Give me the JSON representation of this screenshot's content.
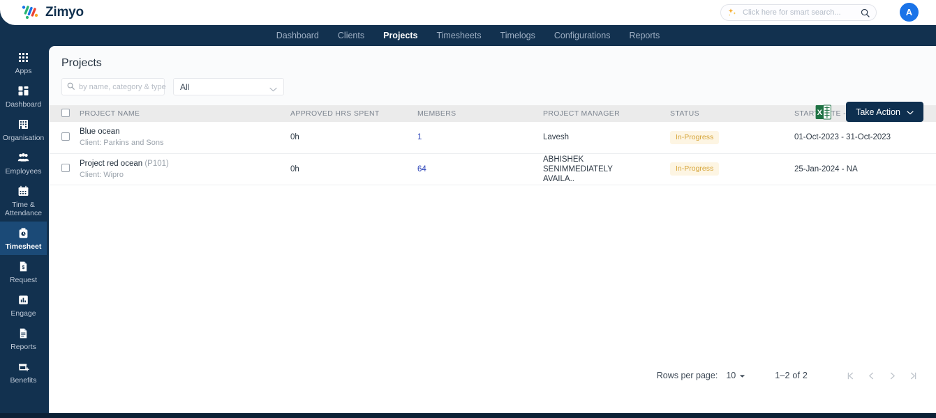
{
  "brand": {
    "name": "Zimyo",
    "logo_icon": "zimyo-logo-icon"
  },
  "topbar": {
    "search": {
      "placeholder": "Click here for smart search...",
      "value": "",
      "sparkle_icon": "sparkle-icon",
      "magnifier_icon": "search-icon"
    },
    "avatar_initial": "A",
    "avatar_color": "#1a73e8"
  },
  "nav": {
    "items": [
      {
        "label": "Dashboard",
        "active": false
      },
      {
        "label": "Clients",
        "active": false
      },
      {
        "label": "Projects",
        "active": true
      },
      {
        "label": "Timesheets",
        "active": false
      },
      {
        "label": "Timelogs",
        "active": false
      },
      {
        "label": "Configurations",
        "active": false
      },
      {
        "label": "Reports",
        "active": false
      }
    ]
  },
  "sidebar": {
    "items": [
      {
        "label": "Apps",
        "icon": "apps-grid-icon",
        "active": false
      },
      {
        "label": "Dashboard",
        "icon": "dashboard-squares-icon",
        "active": false
      },
      {
        "label": "Organisation",
        "icon": "building-icon",
        "active": false
      },
      {
        "label": "Employees",
        "icon": "people-icon",
        "active": false
      },
      {
        "label": "Time & Attendance",
        "icon": "calendar-icon",
        "active": false
      },
      {
        "label": "Timesheet",
        "icon": "timesheet-clock-icon",
        "active": true
      },
      {
        "label": "Request",
        "icon": "request-document-icon",
        "active": false
      },
      {
        "label": "Engage",
        "icon": "engage-chart-icon",
        "active": false
      },
      {
        "label": "Reports",
        "icon": "reports-document-icon",
        "active": false
      },
      {
        "label": "Benefits",
        "icon": "benefits-cart-icon",
        "active": false
      }
    ]
  },
  "page": {
    "title": "Projects",
    "search": {
      "placeholder": "by name, category & type",
      "value": ""
    },
    "filter_select": {
      "value": "All"
    },
    "export_icon": "excel-export-icon",
    "take_action_label": "Take Action"
  },
  "table": {
    "columns": [
      "PROJECT NAME",
      "APPROVED HRS SPENT",
      "MEMBERS",
      "PROJECT MANAGER",
      "STATUS",
      "START DATE - END DATE"
    ],
    "rows": [
      {
        "name": "Blue ocean",
        "code": "",
        "client": "Client: Parkins and Sons",
        "approved_hrs": "0h",
        "members": "1",
        "project_manager": "Lavesh",
        "status": "In-Progress",
        "dates": "01-Oct-2023 - 31-Oct-2023"
      },
      {
        "name": "Project red ocean",
        "code": "(P101)",
        "client": "Client: Wipro",
        "approved_hrs": "0h",
        "members": "64",
        "project_manager": "ABHISHEK SENIMMEDIATELY AVAILA..",
        "status": "In-Progress",
        "dates": "25-Jan-2024 - NA"
      }
    ]
  },
  "pagination": {
    "rows_per_page_label": "Rows per page:",
    "rows_per_page_value": "10",
    "range": "1–2 of 2",
    "first_icon": "first-page-icon",
    "prev_icon": "previous-page-icon",
    "next_icon": "next-page-icon",
    "last_icon": "last-page-icon"
  },
  "colors": {
    "navy": "#12314f",
    "accent_blue": "#1a73e8",
    "link": "#2b43b8",
    "status_badge_bg": "#fdf5e3",
    "status_badge_text": "#d5a437"
  }
}
